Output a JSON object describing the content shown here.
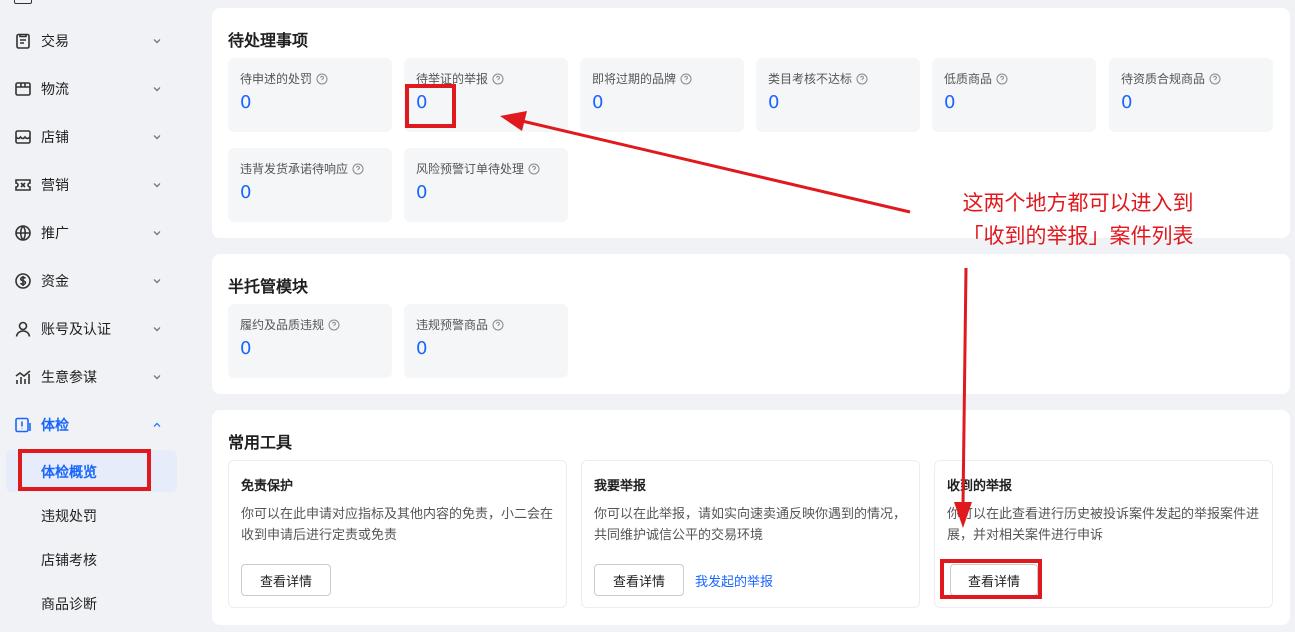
{
  "sidebar": {
    "items": [
      {
        "label": "交易",
        "icon": "clipboard-icon"
      },
      {
        "label": "物流",
        "icon": "truck-icon"
      },
      {
        "label": "店铺",
        "icon": "store-icon"
      },
      {
        "label": "营销",
        "icon": "ticket-icon"
      },
      {
        "label": "推广",
        "icon": "globe-icon"
      },
      {
        "label": "资金",
        "icon": "dollar-icon"
      },
      {
        "label": "账号及认证",
        "icon": "user-icon"
      },
      {
        "label": "生意参谋",
        "icon": "bar-chart-icon"
      },
      {
        "label": "体检",
        "icon": "health-check-icon"
      }
    ],
    "sub_items": [
      {
        "label": "体检概览"
      },
      {
        "label": "违规处罚"
      },
      {
        "label": "店铺考核"
      },
      {
        "label": "商品诊断"
      }
    ]
  },
  "pending": {
    "title": "待处理事项",
    "metrics": [
      {
        "label": "待申述的处罚",
        "value": "0"
      },
      {
        "label": "待举证的举报",
        "value": "0"
      },
      {
        "label": "即将过期的品牌",
        "value": "0"
      },
      {
        "label": "类目考核不达标",
        "value": "0"
      },
      {
        "label": "低质商品",
        "value": "0"
      },
      {
        "label": "待资质合规商品",
        "value": "0"
      },
      {
        "label": "违背发货承诺待响应",
        "value": "0"
      },
      {
        "label": "风险预警订单待处理",
        "value": "0"
      }
    ]
  },
  "semi": {
    "title": "半托管模块",
    "metrics": [
      {
        "label": "履约及品质违规",
        "value": "0"
      },
      {
        "label": "违规预警商品",
        "value": "0"
      }
    ]
  },
  "tools": {
    "title": "常用工具",
    "cards": [
      {
        "title": "免责保护",
        "desc": "你可以在此申请对应指标及其他内容的免责，小二会在收到申请后进行定责或免责",
        "button": "查看详情"
      },
      {
        "title": "我要举报",
        "desc": "你可以在此举报，请如实向速卖通反映你遇到的情况，共同维护诚信公平的交易环境",
        "button": "查看详情",
        "link": "我发起的举报"
      },
      {
        "title": "收到的举报",
        "desc": "你可以在此查看进行历史被投诉案件发起的举报案件进展，并对相关案件进行申诉",
        "button": "查看详情"
      }
    ]
  },
  "annotation": {
    "line1": "这两个地方都可以进入到",
    "line2": "「收到的举报」案件列表",
    "color": "#e0191e"
  },
  "colors": {
    "accent": "#1966ff",
    "annotation": "#e0191e"
  }
}
